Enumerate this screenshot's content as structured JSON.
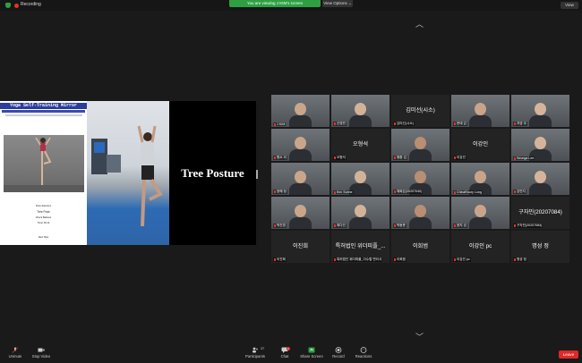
{
  "topbar": {
    "recording_label": "Recording",
    "viewing_banner": "You are viewing J KIM's screen",
    "view_options_label": "View Options ⌄",
    "view_label": "View"
  },
  "share": {
    "app_title": "Yoga Self-Training Mirror",
    "app_lines": [
      "Pose Selection",
      "Tree Pose",
      "Check Balance",
      "Timer 00:12",
      "Next Step"
    ],
    "posture_text": "Tree Posture"
  },
  "gallery": {
    "tiles": [
      {
        "name": "J KIM",
        "big": "",
        "video": true
      },
      {
        "name": "신영빈",
        "big": "",
        "video": true
      },
      {
        "name": "김미선(시소)",
        "big": "김미선(시소)",
        "video": false
      },
      {
        "name": "문태 갑",
        "big": "",
        "video": true
      },
      {
        "name": "지영 우",
        "big": "",
        "video": true
      },
      {
        "name": "원소 리",
        "big": "",
        "video": true,
        "selected": true
      },
      {
        "name": "오형석",
        "big": "오형석",
        "video": false
      },
      {
        "name": "형환 김",
        "big": "",
        "video": true
      },
      {
        "name": "이강인",
        "big": "이강인",
        "video": false
      },
      {
        "name": "Seonga Lee",
        "big": "",
        "video": true
      },
      {
        "name": "윤혜 정",
        "big": "",
        "video": true
      },
      {
        "name": "Kim Sunhe",
        "big": "",
        "video": true
      },
      {
        "name": "채희은(20207040)",
        "big": "",
        "video": true
      },
      {
        "name": "ChinaRoury Long",
        "big": "",
        "video": true
      },
      {
        "name": "김민지",
        "big": "",
        "video": true
      },
      {
        "name": "박진영",
        "big": "",
        "video": true
      },
      {
        "name": "최다인",
        "big": "",
        "video": true
      },
      {
        "name": "박동준",
        "big": "",
        "video": true
      },
      {
        "name": "윤지 성",
        "big": "",
        "video": true
      },
      {
        "name": "구자민(20207084)",
        "big": "구자민(20207084)",
        "video": false
      },
      {
        "name": "이진희",
        "big": "이진희",
        "video": false
      },
      {
        "name": "특허법인 위더피플_이수철 변리사",
        "big": "특허법인 위더피플_...",
        "video": false
      },
      {
        "name": "이희범",
        "big": "이희범",
        "video": false
      },
      {
        "name": "이강인 pc",
        "big": "이강인 pc",
        "video": false
      },
      {
        "name": "명성 정",
        "big": "명성 정",
        "video": false
      }
    ]
  },
  "controls": {
    "unmute": "Unmute",
    "stop_video": "Stop Video",
    "participants": "Participants",
    "participants_count": "37",
    "chat": "Chat",
    "chat_badge": "1",
    "share_screen": "Share Screen",
    "record": "Record",
    "reactions": "Reactions",
    "leave": "Leave"
  },
  "colors": {
    "accent_green": "#2ea043",
    "leave_red": "#e02828",
    "app_header_blue": "#2a3d9c",
    "selected_border": "#b6d33a"
  }
}
